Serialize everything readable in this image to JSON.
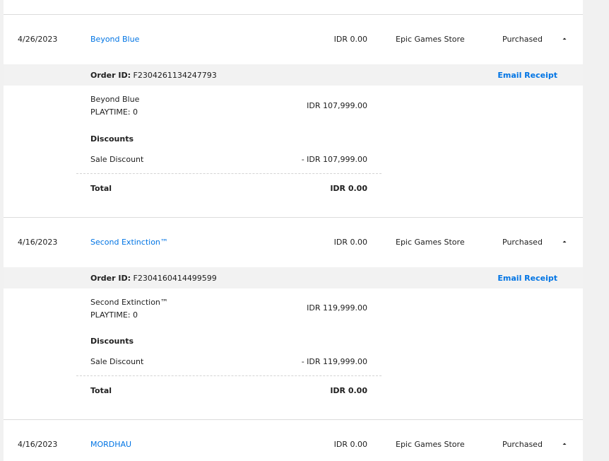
{
  "orders": [
    {
      "date": "4/26/2023",
      "title": "Beyond Blue",
      "price": "IDR 0.00",
      "store": "Epic Games Store",
      "status": "Purchased",
      "order_id_label": "Order ID:",
      "order_id": "F2304261134247793",
      "email_label": "Email Receipt",
      "item_name": "Beyond Blue",
      "playtime": "PLAYTIME: 0",
      "item_price": "IDR 107,999.00",
      "discounts_label": "Discounts",
      "discount_name": "Sale Discount",
      "discount_value": "- IDR 107,999.00",
      "total_label": "Total",
      "total_value": "IDR 0.00"
    },
    {
      "date": "4/16/2023",
      "title": "Second Extinction™",
      "price": "IDR 0.00",
      "store": "Epic Games Store",
      "status": "Purchased",
      "order_id_label": "Order ID:",
      "order_id": "F2304160414499599",
      "email_label": "Email Receipt",
      "item_name": "Second Extinction™",
      "playtime": "PLAYTIME: 0",
      "item_price": "IDR 119,999.00",
      "discounts_label": "Discounts",
      "discount_name": "Sale Discount",
      "discount_value": "- IDR 119,999.00",
      "total_label": "Total",
      "total_value": "IDR 0.00"
    },
    {
      "date": "4/16/2023",
      "title": "MORDHAU",
      "price": "IDR 0.00",
      "store": "Epic Games Store",
      "status": "Purchased"
    }
  ],
  "icons": {
    "expand_toggle": "caret-up-icon"
  },
  "colors": {
    "link": "#0074e4",
    "order_bar": "#f2f2f2",
    "background": "#f1f1f1"
  }
}
